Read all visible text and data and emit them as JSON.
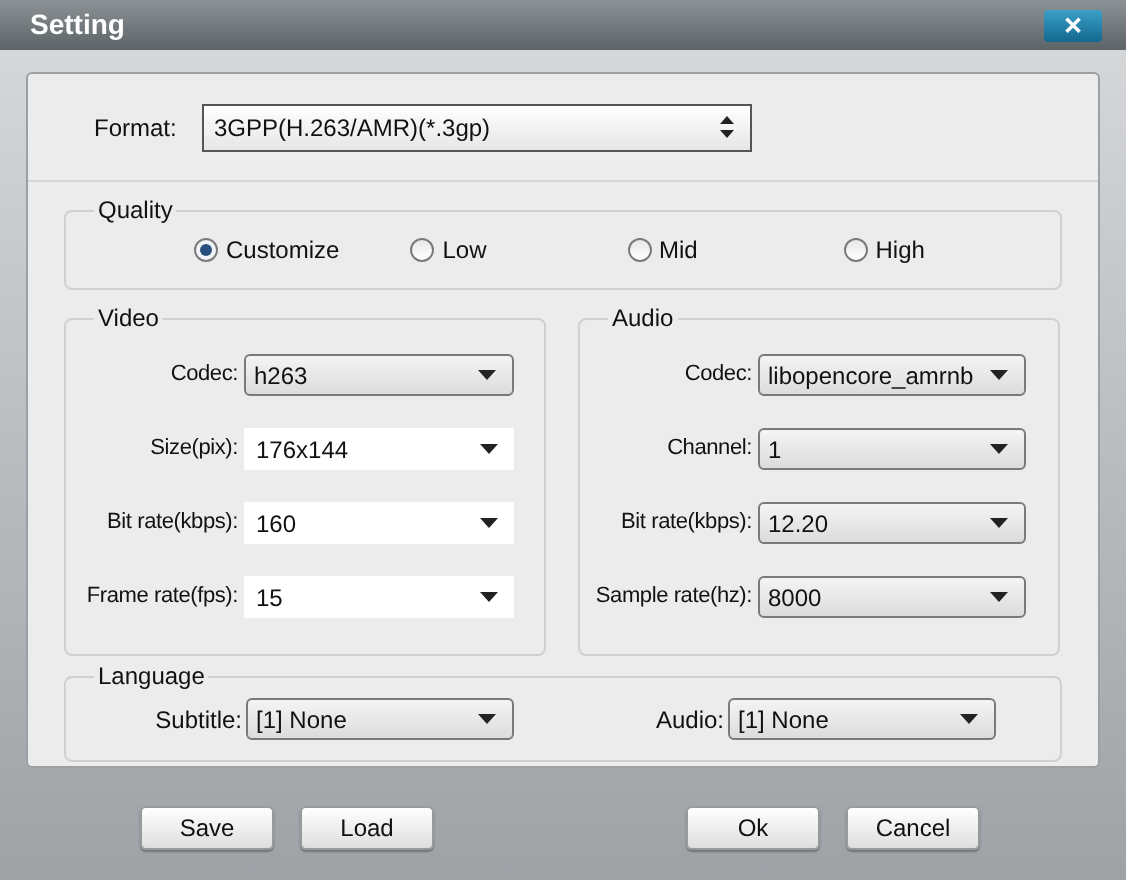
{
  "window": {
    "title": "Setting",
    "close": "✕"
  },
  "format": {
    "label": "Format:",
    "value": "3GPP(H.263/AMR)(*.3gp)"
  },
  "quality": {
    "title": "Quality",
    "options": [
      {
        "label": "Customize",
        "selected": true
      },
      {
        "label": "Low",
        "selected": false
      },
      {
        "label": "Mid",
        "selected": false
      },
      {
        "label": "High",
        "selected": false
      }
    ]
  },
  "video": {
    "title": "Video",
    "fields": [
      {
        "label": "Codec:",
        "value": "h263",
        "kind": "combo"
      },
      {
        "label": "Size(pix):",
        "value": "176x144",
        "kind": "editable"
      },
      {
        "label": "Bit rate(kbps):",
        "value": "160",
        "kind": "editable"
      },
      {
        "label": "Frame rate(fps):",
        "value": "15",
        "kind": "editable"
      }
    ]
  },
  "audio": {
    "title": "Audio",
    "fields": [
      {
        "label": "Codec:",
        "value": "libopencore_amrnb",
        "kind": "combo"
      },
      {
        "label": "Channel:",
        "value": "1",
        "kind": "combo"
      },
      {
        "label": "Bit rate(kbps):",
        "value": "12.20",
        "kind": "combo"
      },
      {
        "label": "Sample rate(hz):",
        "value": "8000",
        "kind": "combo"
      }
    ]
  },
  "language": {
    "title": "Language",
    "subtitle": {
      "label": "Subtitle:",
      "value": "[1] None"
    },
    "audio": {
      "label": "Audio:",
      "value": "[1] None"
    }
  },
  "buttons": [
    "Save",
    "Load",
    "Ok",
    "Cancel"
  ]
}
